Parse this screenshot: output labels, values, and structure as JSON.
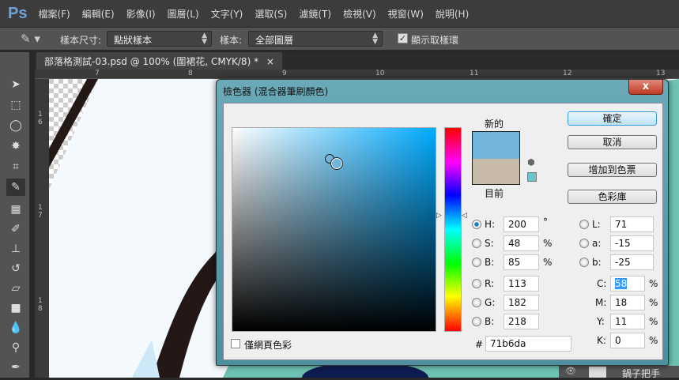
{
  "app": {
    "logo": "Ps"
  },
  "menu": [
    "檔案(F)",
    "編輯(E)",
    "影像(I)",
    "圖層(L)",
    "文字(Y)",
    "選取(S)",
    "濾鏡(T)",
    "檢視(V)",
    "視窗(W)",
    "說明(H)"
  ],
  "options": {
    "sample_size_label": "樣本尺寸:",
    "sample_size_value": "點狀樣本",
    "sample_label": "樣本:",
    "sample_value": "全部圖層",
    "show_ring_label": "顯示取樣環",
    "show_ring_checked": true
  },
  "document": {
    "tab_title": "部落格測試-03.psd @ 100% (圍裙花, CMYK/8) *",
    "close": "×"
  },
  "rulers": {
    "h": [
      "7",
      "8",
      "9",
      "10",
      "11",
      "12",
      "13"
    ],
    "v": [
      "16",
      "17",
      "18"
    ]
  },
  "dialog": {
    "title": "檢色器 (混合器筆刷顏色)",
    "close": "x",
    "new_label": "新的",
    "current_label": "目前",
    "new_color": "#71b6da",
    "current_color": "#c8baa8",
    "buttons": {
      "ok": "確定",
      "cancel": "取消",
      "add_swatch": "增加到色票",
      "libraries": "色彩庫"
    },
    "web_only_label": "僅網頁色彩",
    "hsb": {
      "h": {
        "label": "H:",
        "value": "200",
        "unit": "°"
      },
      "s": {
        "label": "S:",
        "value": "48",
        "unit": "%"
      },
      "b": {
        "label": "B:",
        "value": "85",
        "unit": "%"
      }
    },
    "rgb": {
      "r": {
        "label": "R:",
        "value": "113"
      },
      "g": {
        "label": "G:",
        "value": "182"
      },
      "b": {
        "label": "B:",
        "value": "218"
      }
    },
    "lab": {
      "l": {
        "label": "L:",
        "value": "71"
      },
      "a": {
        "label": "a:",
        "value": "-15"
      },
      "b": {
        "label": "b:",
        "value": "-25"
      }
    },
    "cmyk": {
      "c": {
        "label": "C:",
        "value": "58"
      },
      "m": {
        "label": "M:",
        "value": "18"
      },
      "y": {
        "label": "Y:",
        "value": "11"
      },
      "k": {
        "label": "K:",
        "value": "0"
      },
      "unit": "%"
    },
    "hex_label": "#",
    "hex": "71b6da"
  },
  "layers": {
    "visible_layer": "鍋子把手"
  }
}
